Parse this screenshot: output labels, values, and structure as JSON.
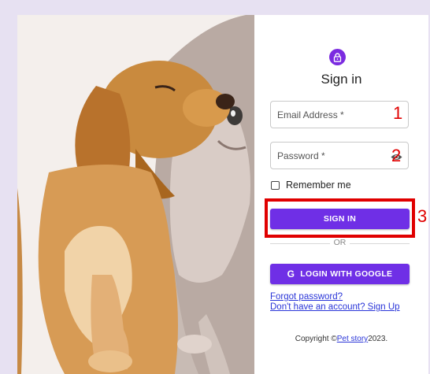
{
  "form": {
    "title": "Sign in",
    "email_label": "Email Address *",
    "password_label": "Password *",
    "remember_label": "Remember me",
    "sign_in_label": "SIGN IN",
    "divider_text": "OR",
    "google_label": "LOGIN WITH GOOGLE",
    "forgot_link": "Forgot password?",
    "signup_link": "Don't have an account? Sign Up"
  },
  "footer": {
    "copyright_prefix": "Copyright ©",
    "brand_link": "Pet story",
    "year": "2023."
  },
  "annotations": {
    "step1": "1",
    "step2": "2",
    "step3": "3"
  },
  "icons": {
    "badge": "lock-icon",
    "password_toggle": "eye-icon",
    "google": "google-g-icon"
  },
  "colors": {
    "accent": "#6f2fe6",
    "annotation": "#e00000",
    "link": "#2a35d8",
    "page_bg": "#e7e1f2"
  }
}
